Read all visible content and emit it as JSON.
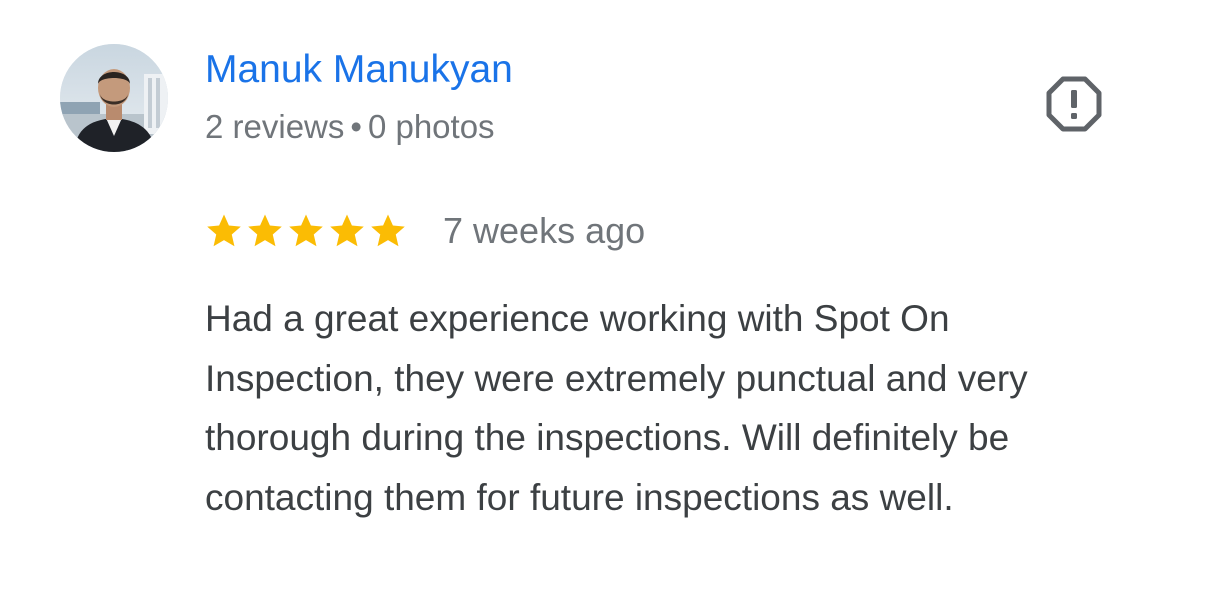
{
  "review": {
    "author": {
      "name": "Manuk Manukyan",
      "reviews_count": "2 reviews",
      "separator": "•",
      "photos_count": "0 photos"
    },
    "rating": {
      "value": 5,
      "max": 5,
      "star_color": "#fbbc04"
    },
    "date": "7 weeks ago",
    "text": "Had a great experience working with Spot On Inspection, they were extremely punctual and very thorough during the inspections. Will definitely be contacting them for future inspections as well.",
    "icons": {
      "flag": "report-flag-icon",
      "star": "star-icon"
    }
  },
  "colors": {
    "name_link": "#1a73e8",
    "secondary_text": "#70757a",
    "body_text": "#3c4043",
    "icon": "#5f6368"
  }
}
